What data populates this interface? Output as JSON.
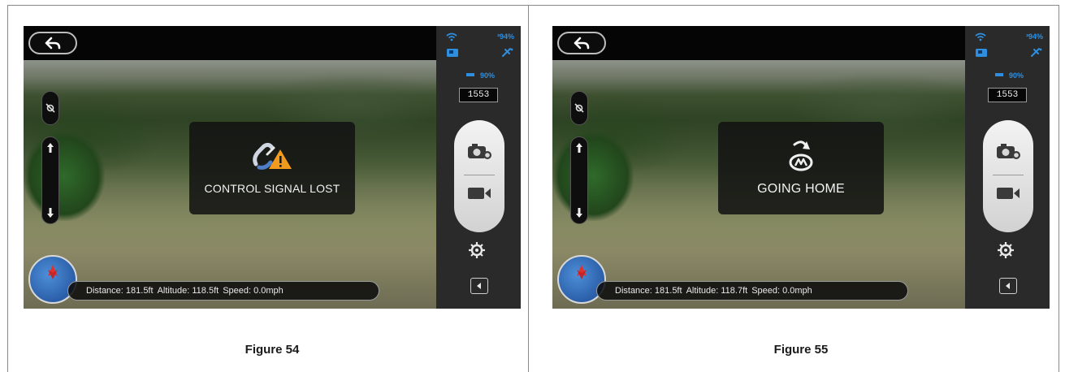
{
  "figures": [
    {
      "caption": "Figure 54",
      "overlay_text": "CONTROL SIGNAL LOST",
      "overlay_icon": "signal-lost-warning-icon",
      "status": {
        "rc_signal": "³94%",
        "wifi_battery": "90%",
        "counter": "1553"
      },
      "telemetry": {
        "distance": "Distance: 181.5ft",
        "altitude": "Altitude: 118.5ft",
        "speed": "Speed:  0.0mph"
      }
    },
    {
      "caption": "Figure 55",
      "overlay_text": "GOING HOME",
      "overlay_icon": "going-home-icon",
      "status": {
        "rc_signal": "³94%",
        "wifi_battery": "90%",
        "counter": "1553"
      },
      "telemetry": {
        "distance": "Distance: 181.5ft",
        "altitude": "Altitude: 118.7ft",
        "speed": "Speed:  0.0mph"
      }
    }
  ],
  "colors": {
    "accent_blue": "#2e8fe0",
    "warning_orange": "#f29a1b",
    "compass_blue": "#2b5ea8"
  }
}
